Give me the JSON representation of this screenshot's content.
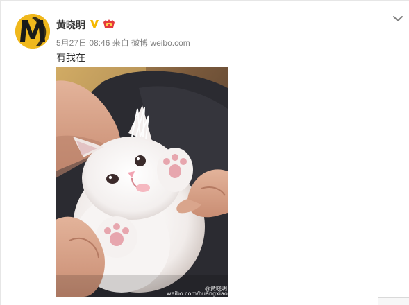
{
  "post": {
    "author": {
      "name": "黄晓明",
      "avatar_icon": "black-m-logo-on-yellow",
      "verified_icon": "verified-v-icon",
      "member_icon": "vip-member-icon"
    },
    "meta": {
      "time": "5月27日 08:46",
      "source_prefix": "来自",
      "source": "微博 weibo.com"
    },
    "text": "有我在",
    "image": {
      "subject": "white fluffy kitten held in hands",
      "watermark_handle": "@黄晓明",
      "watermark_url": "weibo.com/huangxiaoming"
    },
    "menu_icon": "chevron-down-icon"
  },
  "colors": {
    "avatar_bg": "#f0b81c",
    "name": "#333333",
    "meta": "#808080",
    "verified": "#f5b800",
    "member": "#e4393c"
  }
}
